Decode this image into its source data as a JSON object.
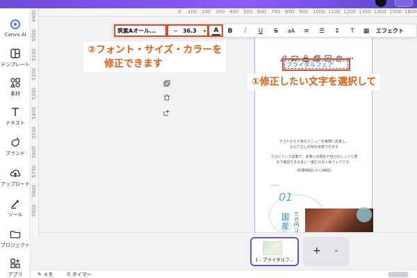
{
  "sidebar": {
    "items": [
      {
        "label": "Canva AI",
        "icon": "canva-ai-icon"
      },
      {
        "label": "テンプレート",
        "icon": "template-icon"
      },
      {
        "label": "素材",
        "icon": "elements-icon"
      },
      {
        "label": "テキスト",
        "icon": "text-icon"
      },
      {
        "label": "ブランド",
        "icon": "brand-icon"
      },
      {
        "label": "アップロード",
        "icon": "upload-icon"
      },
      {
        "label": "ツール",
        "icon": "tools-icon"
      },
      {
        "label": "プロジェクト",
        "icon": "project-icon"
      },
      {
        "label": "アプリ",
        "icon": "apps-icon"
      }
    ]
  },
  "rulers": {
    "vertical": [
      "4900",
      "5000",
      "5100",
      "5200",
      "5300",
      "5400",
      "5500",
      "5600",
      "5700",
      "5800",
      "5900"
    ],
    "horizontal": [
      "0",
      "100",
      "200",
      "300",
      "400",
      "500",
      "600",
      "700",
      "800",
      "900",
      "1000",
      "1100",
      "1200",
      "1300",
      "1400",
      "1500",
      "1600"
    ]
  },
  "toolbar": {
    "font_name": "筑紫Aオール...",
    "font_size_minus": "−",
    "font_size": "36.3",
    "font_size_plus": "+",
    "color_label": "A",
    "bold": "B",
    "italic": "I",
    "underline": "U",
    "strikethrough": "S",
    "case": "aA",
    "align": "≡",
    "list": "☰",
    "spacing": "↕",
    "vertical_text": "T",
    "checker": "▦",
    "effect": "エフェクト"
  },
  "annotations": {
    "font_hint_line1": "②フォント・サイズ・カラーを",
    "font_hint_line2": "修正できます",
    "select_hint": "①修正したい文字を選択して"
  },
  "page": {
    "title_prefix": "春",
    "selected_text": "ブライダルフェア",
    "paragraph1": "ゲストから人気のメニューを実際に試食し、\nおもてなしの味を体感できます",
    "paragraph2": "さらにドレス試着で、会場との相性や自分のしっくり感\nまで確認できる本に一度だけの人気フェアです。",
    "note": "（所要時間1.5～2時間）",
    "point_label": "point",
    "point_number": "01",
    "kokusan_text": "国産牛",
    "menu_text": "三ガ円コースの"
  },
  "page_strip": {
    "thumb_label": "1 - ブライダルフ...",
    "add_label": "+",
    "add_menu": "⌄"
  },
  "statusbar": {
    "memo": "メモ",
    "timer": "タイマー"
  },
  "colors": {
    "accent": "#6f4bd8",
    "annotation": "#e85a12",
    "highlight_box": "#e04a1e"
  }
}
